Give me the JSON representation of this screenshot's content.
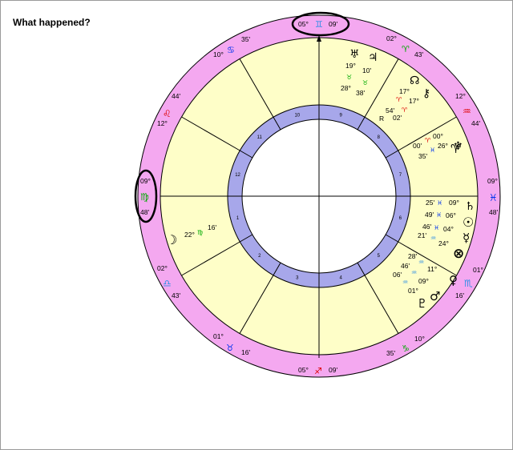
{
  "page": {
    "title": "What happened?"
  },
  "colors": {
    "ring": "#f4a8f0",
    "field": "#fefec8",
    "house_ring": "#a7a7ea",
    "fire": "#dd0000",
    "earth": "#00aa00",
    "air": "#2f8fe6",
    "water": "#0033ee",
    "lines": "#000000"
  },
  "angles": {
    "asc": {
      "deg": "09°",
      "sign": "virgo-icon",
      "glyph": "♍",
      "min": "48'"
    },
    "desc": {
      "deg": "09°",
      "sign": "pisces-icon",
      "glyph": "♓",
      "min": "48'"
    },
    "mc": {
      "deg": "05°",
      "sign": "gemini-icon",
      "glyph": "♊",
      "min": "09'"
    },
    "ic": {
      "deg": "05°",
      "sign": "sagittarius-icon",
      "glyph": "♐",
      "min": "09'"
    }
  },
  "cusps": [
    {
      "house": 2,
      "deg": "02°",
      "glyph": "♎",
      "sign": "libra-icon",
      "min": "43'"
    },
    {
      "house": 3,
      "deg": "01°",
      "glyph": "♏",
      "sign": "scorpio-icon",
      "min": "16'"
    },
    {
      "house": 5,
      "deg": "10°",
      "glyph": "♑",
      "sign": "capricorn-icon",
      "min": "35'"
    },
    {
      "house": 6,
      "deg": "12°",
      "glyph": "♒",
      "sign": "aquarius-icon",
      "min": "44'"
    },
    {
      "house": 8,
      "deg": "02°",
      "glyph": "♈",
      "sign": "aries-icon",
      "min": "43'"
    },
    {
      "house": 9,
      "deg": "01°",
      "glyph": "♉",
      "sign": "taurus-icon",
      "min": "16'"
    },
    {
      "house": 11,
      "deg": "10°",
      "glyph": "♋",
      "sign": "cancer-icon",
      "min": "35'"
    },
    {
      "house": 12,
      "deg": "12°",
      "glyph": "♌",
      "sign": "leo-icon",
      "min": "44'"
    }
  ],
  "houses": [
    "1",
    "2",
    "3",
    "4",
    "5",
    "6",
    "7",
    "8",
    "9",
    "10",
    "11",
    "12"
  ],
  "planets": [
    {
      "name": "uranus",
      "glyph": "♅",
      "icon": "uranus-icon",
      "deg": "28°",
      "sign": "♉",
      "min": "38'",
      "retro": ""
    },
    {
      "name": "jupiter",
      "glyph": "♃",
      "icon": "jupiter-icon",
      "deg": "19°",
      "sign": "♉",
      "min": "10'",
      "retro": ""
    },
    {
      "name": "node",
      "glyph": "☊",
      "icon": "north-node-icon",
      "deg": "17°",
      "sign": "♈",
      "min": "54'",
      "retro": ""
    },
    {
      "name": "chiron",
      "glyph": "⚷",
      "icon": "chiron-icon",
      "deg": "17°",
      "sign": "♈",
      "min": "02'",
      "retro": "R"
    },
    {
      "name": "mars-a",
      "glyph": "♈",
      "icon": "aries-marker-icon",
      "deg": "00°",
      "sign": "♈",
      "min": "",
      "retro": ""
    },
    {
      "name": "neptune",
      "glyph": "♆",
      "icon": "neptune-icon",
      "deg": "26°",
      "sign": "♓",
      "min": "00'",
      "extra": "35'"
    },
    {
      "name": "saturn",
      "glyph": "♄",
      "icon": "saturn-icon",
      "deg": "09°",
      "sign": "♓",
      "min": "25'"
    },
    {
      "name": "sun",
      "glyph": "☉",
      "icon": "sun-icon",
      "deg": "06°",
      "sign": "♓",
      "min": "49'"
    },
    {
      "name": "mercury",
      "glyph": "☿",
      "icon": "mercury-icon",
      "deg": "04°",
      "sign": "♓",
      "min": "46'"
    },
    {
      "name": "fortune",
      "glyph": "⊗",
      "icon": "part-of-fortune-icon",
      "deg": "24°",
      "sign": "♒",
      "min": "21'"
    },
    {
      "name": "venus",
      "glyph": "♀",
      "icon": "venus-icon",
      "deg": "11°",
      "sign": "♒",
      "min": "28'"
    },
    {
      "name": "mars",
      "glyph": "♂",
      "icon": "mars-icon",
      "deg": "09°",
      "sign": "♒",
      "min": "46'"
    },
    {
      "name": "pluto",
      "glyph": "♇",
      "icon": "pluto-icon",
      "deg": "01°",
      "sign": "♒",
      "min": "06'"
    },
    {
      "name": "moon",
      "glyph": "☽",
      "icon": "moon-icon",
      "deg": "22°",
      "sign": "♍",
      "min": "16'"
    }
  ]
}
